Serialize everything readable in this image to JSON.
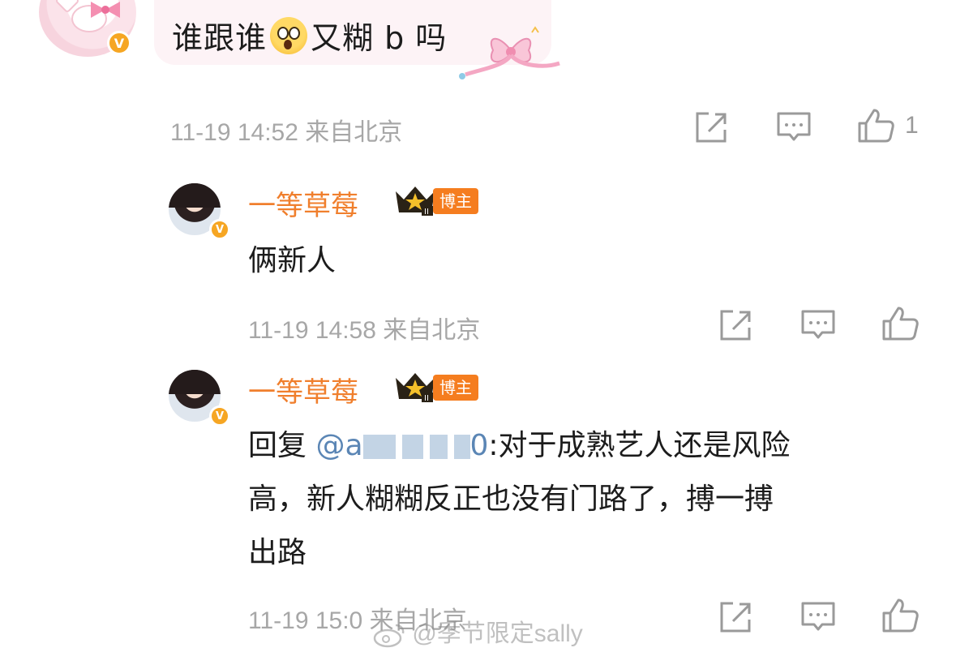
{
  "top_comment": {
    "text_before": "谁跟谁",
    "emoji": "astonished-face-emoji",
    "text_after": "又糊 b 吗",
    "time": "11-19 14:52",
    "location": "来自北京",
    "like_count": "1"
  },
  "replies": [
    {
      "username": "一等草莓",
      "badge_label": "博主",
      "text": "俩新人",
      "time": "11-19 14:58",
      "location": "来自北京"
    },
    {
      "username": "一等草莓",
      "badge_label": "博主",
      "reply_prefix": "回复 ",
      "mention_start": "@a",
      "mention_end": "0",
      "text_line1": ":对于成熟艺人还是风险",
      "text_line2": "高，新人糊糊反正也没有门路了，搏一搏",
      "text_line3": "出路",
      "time": "11-19 15:0",
      "location": "来自北京"
    }
  ],
  "watermark": "@季节限定sally",
  "icons": {
    "verified": "V",
    "share": "share-icon",
    "comment": "comment-icon",
    "like": "thumbs-up-icon"
  },
  "colors": {
    "username": "#f07f2d",
    "badge_bg": "#f57d1f",
    "mention": "#5b86b5",
    "meta_text": "#a7a7a7",
    "verified": "#f6a623"
  }
}
